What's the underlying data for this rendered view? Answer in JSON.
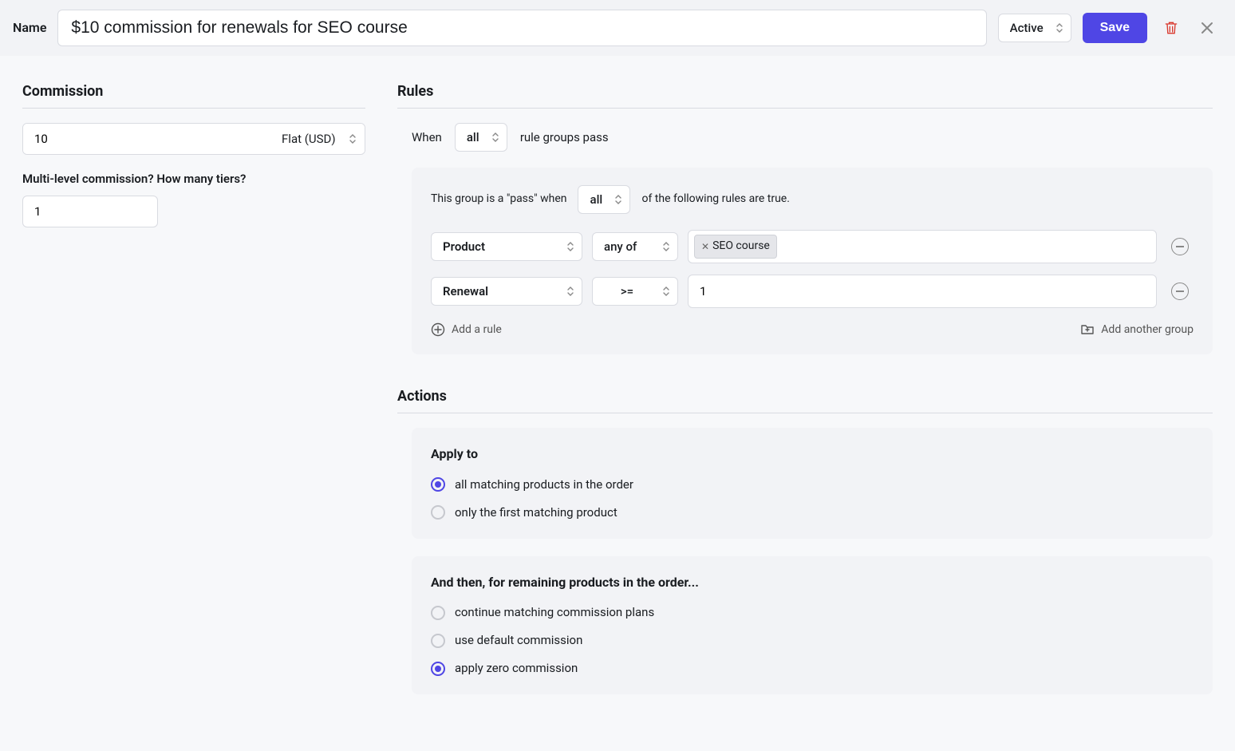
{
  "header": {
    "name_label": "Name",
    "name_value": "$10 commission for renewals for SEO course",
    "status": "Active",
    "save_label": "Save"
  },
  "commission": {
    "title": "Commission",
    "amount": "10",
    "type": "Flat (USD)",
    "tiers_label": "Multi-level commission? How many tiers?",
    "tiers_value": "1"
  },
  "rules": {
    "title": "Rules",
    "when_prefix": "When",
    "when_mode": "all",
    "when_suffix": "rule groups pass",
    "group": {
      "prefix": "This group is a \"pass\" when",
      "mode": "all",
      "suffix": "of the following rules are true.",
      "rows": [
        {
          "field": "Product",
          "op": "any of",
          "tag": "SEO course"
        },
        {
          "field": "Renewal",
          "op": ">=",
          "value": "1"
        }
      ],
      "add_rule": "Add a rule",
      "add_group": "Add another group"
    }
  },
  "actions": {
    "title": "Actions",
    "apply": {
      "heading": "Apply to",
      "options": [
        {
          "label": "all matching products in the order",
          "selected": true
        },
        {
          "label": "only the first matching product",
          "selected": false
        }
      ]
    },
    "then": {
      "heading": "And then, for remaining products in the order...",
      "options": [
        {
          "label": "continue matching commission plans",
          "selected": false
        },
        {
          "label": "use default commission",
          "selected": false
        },
        {
          "label": "apply zero commission",
          "selected": true
        }
      ]
    }
  }
}
